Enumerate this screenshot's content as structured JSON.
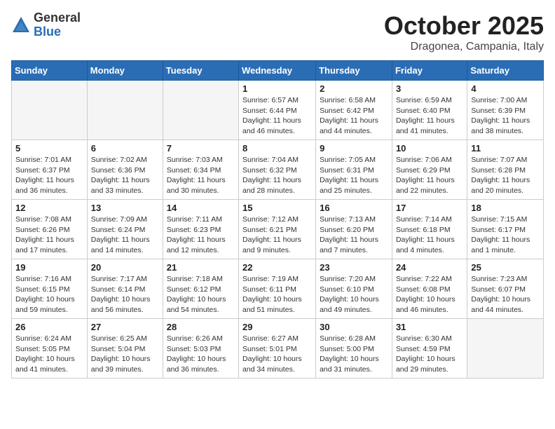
{
  "logo": {
    "general": "General",
    "blue": "Blue"
  },
  "title": "October 2025",
  "location": "Dragonea, Campania, Italy",
  "days_of_week": [
    "Sunday",
    "Monday",
    "Tuesday",
    "Wednesday",
    "Thursday",
    "Friday",
    "Saturday"
  ],
  "weeks": [
    [
      {
        "day": "",
        "info": ""
      },
      {
        "day": "",
        "info": ""
      },
      {
        "day": "",
        "info": ""
      },
      {
        "day": "1",
        "info": "Sunrise: 6:57 AM\nSunset: 6:44 PM\nDaylight: 11 hours and 46 minutes."
      },
      {
        "day": "2",
        "info": "Sunrise: 6:58 AM\nSunset: 6:42 PM\nDaylight: 11 hours and 44 minutes."
      },
      {
        "day": "3",
        "info": "Sunrise: 6:59 AM\nSunset: 6:40 PM\nDaylight: 11 hours and 41 minutes."
      },
      {
        "day": "4",
        "info": "Sunrise: 7:00 AM\nSunset: 6:39 PM\nDaylight: 11 hours and 38 minutes."
      }
    ],
    [
      {
        "day": "5",
        "info": "Sunrise: 7:01 AM\nSunset: 6:37 PM\nDaylight: 11 hours and 36 minutes."
      },
      {
        "day": "6",
        "info": "Sunrise: 7:02 AM\nSunset: 6:36 PM\nDaylight: 11 hours and 33 minutes."
      },
      {
        "day": "7",
        "info": "Sunrise: 7:03 AM\nSunset: 6:34 PM\nDaylight: 11 hours and 30 minutes."
      },
      {
        "day": "8",
        "info": "Sunrise: 7:04 AM\nSunset: 6:32 PM\nDaylight: 11 hours and 28 minutes."
      },
      {
        "day": "9",
        "info": "Sunrise: 7:05 AM\nSunset: 6:31 PM\nDaylight: 11 hours and 25 minutes."
      },
      {
        "day": "10",
        "info": "Sunrise: 7:06 AM\nSunset: 6:29 PM\nDaylight: 11 hours and 22 minutes."
      },
      {
        "day": "11",
        "info": "Sunrise: 7:07 AM\nSunset: 6:28 PM\nDaylight: 11 hours and 20 minutes."
      }
    ],
    [
      {
        "day": "12",
        "info": "Sunrise: 7:08 AM\nSunset: 6:26 PM\nDaylight: 11 hours and 17 minutes."
      },
      {
        "day": "13",
        "info": "Sunrise: 7:09 AM\nSunset: 6:24 PM\nDaylight: 11 hours and 14 minutes."
      },
      {
        "day": "14",
        "info": "Sunrise: 7:11 AM\nSunset: 6:23 PM\nDaylight: 11 hours and 12 minutes."
      },
      {
        "day": "15",
        "info": "Sunrise: 7:12 AM\nSunset: 6:21 PM\nDaylight: 11 hours and 9 minutes."
      },
      {
        "day": "16",
        "info": "Sunrise: 7:13 AM\nSunset: 6:20 PM\nDaylight: 11 hours and 7 minutes."
      },
      {
        "day": "17",
        "info": "Sunrise: 7:14 AM\nSunset: 6:18 PM\nDaylight: 11 hours and 4 minutes."
      },
      {
        "day": "18",
        "info": "Sunrise: 7:15 AM\nSunset: 6:17 PM\nDaylight: 11 hours and 1 minute."
      }
    ],
    [
      {
        "day": "19",
        "info": "Sunrise: 7:16 AM\nSunset: 6:15 PM\nDaylight: 10 hours and 59 minutes."
      },
      {
        "day": "20",
        "info": "Sunrise: 7:17 AM\nSunset: 6:14 PM\nDaylight: 10 hours and 56 minutes."
      },
      {
        "day": "21",
        "info": "Sunrise: 7:18 AM\nSunset: 6:12 PM\nDaylight: 10 hours and 54 minutes."
      },
      {
        "day": "22",
        "info": "Sunrise: 7:19 AM\nSunset: 6:11 PM\nDaylight: 10 hours and 51 minutes."
      },
      {
        "day": "23",
        "info": "Sunrise: 7:20 AM\nSunset: 6:10 PM\nDaylight: 10 hours and 49 minutes."
      },
      {
        "day": "24",
        "info": "Sunrise: 7:22 AM\nSunset: 6:08 PM\nDaylight: 10 hours and 46 minutes."
      },
      {
        "day": "25",
        "info": "Sunrise: 7:23 AM\nSunset: 6:07 PM\nDaylight: 10 hours and 44 minutes."
      }
    ],
    [
      {
        "day": "26",
        "info": "Sunrise: 6:24 AM\nSunset: 5:05 PM\nDaylight: 10 hours and 41 minutes."
      },
      {
        "day": "27",
        "info": "Sunrise: 6:25 AM\nSunset: 5:04 PM\nDaylight: 10 hours and 39 minutes."
      },
      {
        "day": "28",
        "info": "Sunrise: 6:26 AM\nSunset: 5:03 PM\nDaylight: 10 hours and 36 minutes."
      },
      {
        "day": "29",
        "info": "Sunrise: 6:27 AM\nSunset: 5:01 PM\nDaylight: 10 hours and 34 minutes."
      },
      {
        "day": "30",
        "info": "Sunrise: 6:28 AM\nSunset: 5:00 PM\nDaylight: 10 hours and 31 minutes."
      },
      {
        "day": "31",
        "info": "Sunrise: 6:30 AM\nSunset: 4:59 PM\nDaylight: 10 hours and 29 minutes."
      },
      {
        "day": "",
        "info": ""
      }
    ]
  ]
}
